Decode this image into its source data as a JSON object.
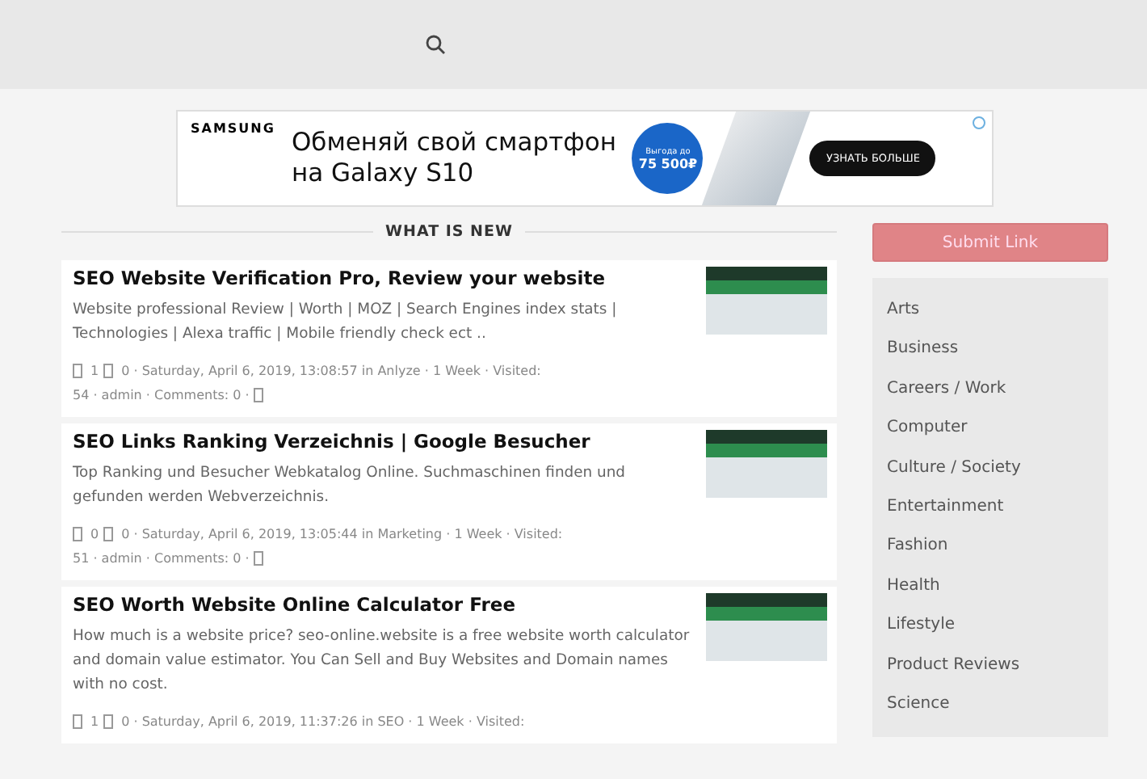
{
  "ad": {
    "brand": "SAMSUNG",
    "headline_1": "Обменяй свой смартфон",
    "headline_2": "на Galaxy S10",
    "badge_1": "Выгода до",
    "badge_2": "75 500₽",
    "cta": "УЗНАТЬ БОЛЬШЕ"
  },
  "section_title": "WHAT IS NEW",
  "posts": [
    {
      "title": "SEO Website Verification Pro, Review your website",
      "description": "Website professional Review | Worth | MOZ | Search Engines index stats | Technologies | Alexa traffic | Mobile friendly check ect ..",
      "likes": "1",
      "meta_1": "0 · Saturday, April 6, 2019, 13:08:57 in Anlyze · 1 Week · Visited:",
      "meta_2": "54 · admin · Comments: 0 ·",
      "end_icon": true
    },
    {
      "title": "SEO Links Ranking Verzeichnis | Google Besucher",
      "description": "Top Ranking und Besucher Webkatalog Online. Suchmaschinen finden und gefunden werden Webverzeichnis.",
      "likes": "0",
      "meta_1": "0 · Saturday, April 6, 2019, 13:05:44 in Marketing · 1 Week · Visited:",
      "meta_2": "51 · admin · Comments: 0 ·",
      "end_icon": true
    },
    {
      "title": "SEO Worth Website Online Calculator Free",
      "description": "How much is a website price? seo-online.website is a free website worth calculator and domain value estimator. You Can Sell and Buy Websites and Domain names with no cost.",
      "likes": "1",
      "meta_1": "0 · Saturday, April 6, 2019, 11:37:26 in SEO · 1 Week · Visited:",
      "end_icon": false
    }
  ],
  "submit_button": "Submit Link",
  "categories": [
    "Arts",
    "Business",
    "Careers / Work",
    "Computer",
    "Culture / Society",
    "Entertainment",
    "Fashion",
    "Health",
    "Lifestyle",
    "Product Reviews",
    "Science"
  ]
}
